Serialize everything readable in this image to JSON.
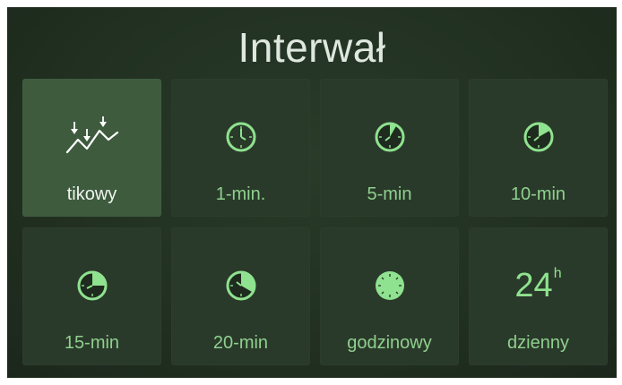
{
  "title": "Interwał",
  "accent_color": "#8fe28f",
  "tiles": [
    {
      "label": "tikowy",
      "icon": "tick-chart-icon",
      "selected": true
    },
    {
      "label": "1-min.",
      "icon": "clock-icon",
      "selected": false,
      "fill_fraction": 0
    },
    {
      "label": "5-min",
      "icon": "clock-icon",
      "selected": false,
      "fill_fraction": 0.083
    },
    {
      "label": "10-min",
      "icon": "clock-icon",
      "selected": false,
      "fill_fraction": 0.167
    },
    {
      "label": "15-min",
      "icon": "clock-icon",
      "selected": false,
      "fill_fraction": 0.25
    },
    {
      "label": "20-min",
      "icon": "clock-icon",
      "selected": false,
      "fill_fraction": 0.333
    },
    {
      "label": "godzinowy",
      "icon": "clock-icon",
      "selected": false,
      "fill_fraction": 1
    },
    {
      "label": "dzienny",
      "icon": "day-24h-icon",
      "selected": false,
      "big_text": "24",
      "superscript": "h"
    }
  ]
}
